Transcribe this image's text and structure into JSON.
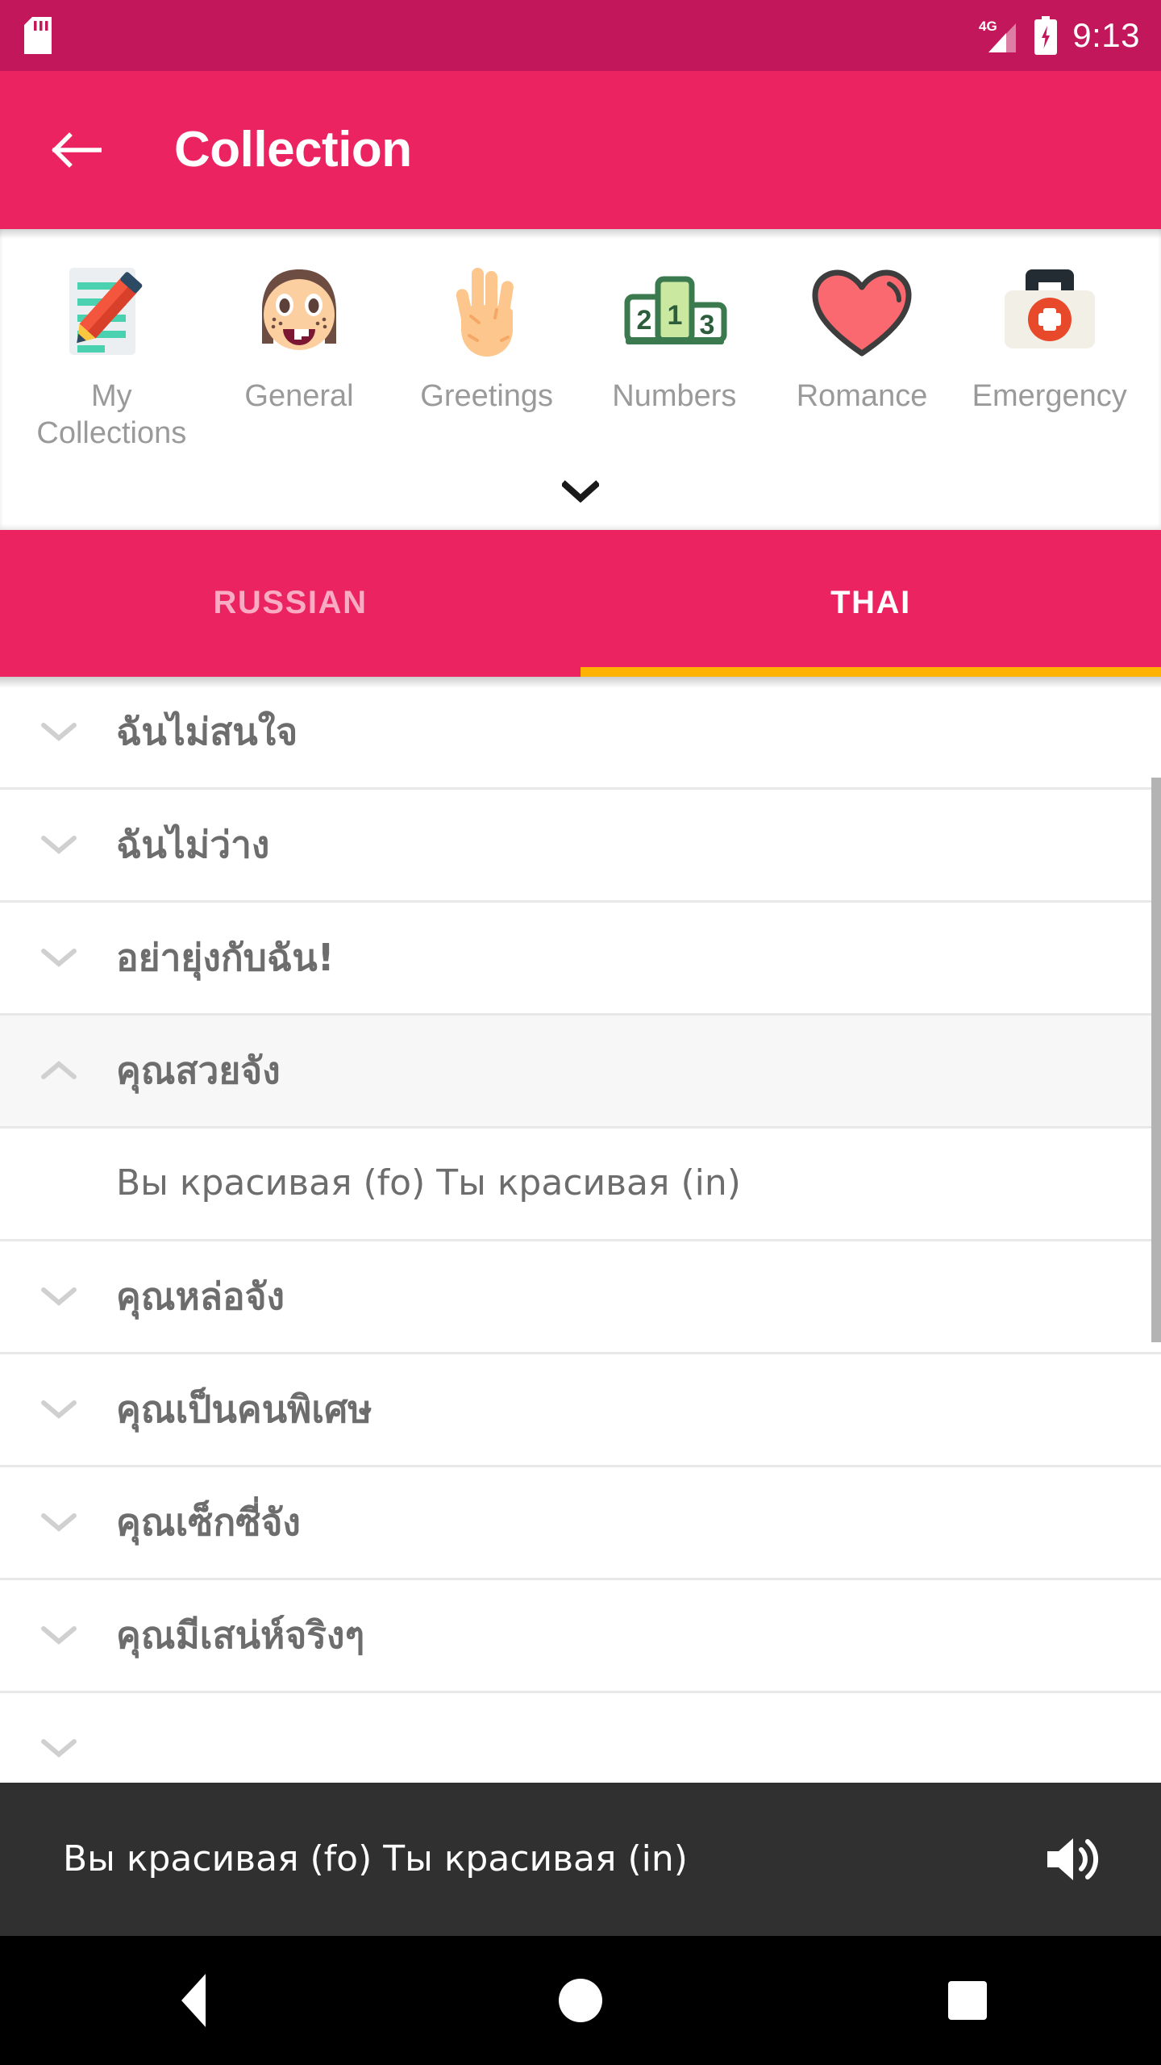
{
  "status_bar": {
    "sd_card_icon": "sd-card-icon",
    "network_label": "4G",
    "signal_icon": "signal-bars-icon",
    "battery_icon": "battery-charging-icon",
    "time": "9:13"
  },
  "app_bar": {
    "back_icon": "back-arrow-icon",
    "title": "Collection"
  },
  "categories": {
    "expand_icon": "chevron-down-icon",
    "items": [
      {
        "label": "My Collections",
        "icon": "memo-pencil-icon"
      },
      {
        "label": "General",
        "icon": "girl-face-icon"
      },
      {
        "label": "Greetings",
        "icon": "raised-hand-icon"
      },
      {
        "label": "Numbers",
        "icon": "podium-icon"
      },
      {
        "label": "Romance",
        "icon": "heart-icon"
      },
      {
        "label": "Emergency",
        "icon": "first-aid-kit-icon"
      }
    ]
  },
  "tabs": {
    "items": [
      {
        "label": "RUSSIAN",
        "active": false
      },
      {
        "label": "THAI",
        "active": true
      }
    ],
    "indicator_color": "#FFB300"
  },
  "phrase_list": {
    "collapsed_icon": "chevron-down-icon",
    "expanded_icon": "chevron-up-icon",
    "rows": [
      {
        "text": "ฉันไม่สนใจ",
        "expanded": false,
        "translation": null
      },
      {
        "text": "ฉันไม่ว่าง",
        "expanded": false,
        "translation": null
      },
      {
        "text": "อย่ายุ่งกับฉัน!",
        "expanded": false,
        "translation": null
      },
      {
        "text": "คุณสวยจัง",
        "expanded": true,
        "translation": "Вы красивая (fo)  Ты красивая (in)"
      },
      {
        "text": "คุณหล่อจัง",
        "expanded": false,
        "translation": null
      },
      {
        "text": "คุณเป็นคนพิเศษ",
        "expanded": false,
        "translation": null
      },
      {
        "text": "คุณเซ็กซี่จัง",
        "expanded": false,
        "translation": null
      },
      {
        "text": "คุณมีเสน่ห์จริงๆ",
        "expanded": false,
        "translation": null
      }
    ]
  },
  "audio_bar": {
    "text": "Вы красивая (fo)  Ты красивая (in)",
    "speaker_icon": "volume-up-icon"
  },
  "nav_bar": {
    "back_icon": "nav-back-triangle-icon",
    "home_icon": "nav-home-circle-icon",
    "recents_icon": "nav-recents-square-icon"
  },
  "colors": {
    "status_bar": "#C2175B",
    "app_bar": "#EC2361",
    "tab_indicator": "#FFB300",
    "audio_bar": "#303030",
    "nav_bar": "#000000",
    "text_secondary": "#6d6d6d",
    "label_gray": "#9a9a9a"
  }
}
